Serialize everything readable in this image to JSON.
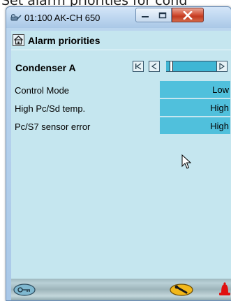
{
  "cut_caption": "Set alarm priorities for cond",
  "window": {
    "title": "01:100 AK-CH 650",
    "minimize_icon": "minimize-icon",
    "maximize_icon": "maximize-icon",
    "close_icon": "close-icon"
  },
  "header": {
    "home_icon": "home-icon",
    "title": "Alarm priorities"
  },
  "section": {
    "title": "Condenser A",
    "nav_icons": [
      "first-page-icon",
      "previous-page-icon",
      "next-page-icon"
    ]
  },
  "rows": [
    {
      "label": "Control Mode",
      "value": "Low"
    },
    {
      "label": "High Pc/Sd temp.",
      "value": "High"
    },
    {
      "label": "Pc/S7 sensor error",
      "value": "High"
    }
  ],
  "status_bar": {
    "left_icon": "login-key-icon",
    "right_icon": "service-wrench-icon",
    "alarm_icon": "alarm-bell-icon"
  },
  "colors": {
    "background": "#c5e6ef",
    "value_cell": "#50c0dc",
    "alarm": "#e01010"
  }
}
